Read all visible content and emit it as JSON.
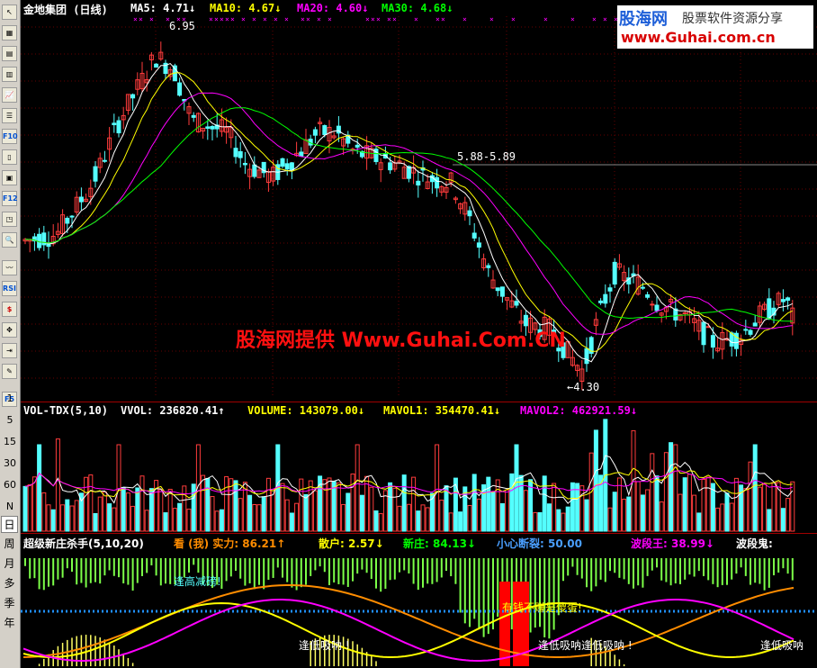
{
  "toolbar": {
    "buttons": [
      {
        "icon": "pointer-icon",
        "glyph": "↖"
      },
      {
        "icon": "grid-icon",
        "glyph": "▦"
      },
      {
        "icon": "table-icon",
        "glyph": "▤"
      },
      {
        "icon": "chart-icon",
        "glyph": "▥"
      },
      {
        "icon": "trend-icon",
        "glyph": "📈"
      },
      {
        "icon": "list-icon",
        "glyph": "☰"
      },
      {
        "icon": "f10-icon",
        "glyph": "F10"
      },
      {
        "icon": "doc-icon",
        "glyph": "▯"
      },
      {
        "icon": "report-icon",
        "glyph": "▣"
      },
      {
        "icon": "f12-icon",
        "glyph": "F12"
      },
      {
        "icon": "window-icon",
        "glyph": "◳"
      },
      {
        "icon": "search-icon",
        "glyph": "🔍"
      },
      {
        "icon": "wave-icon",
        "glyph": "〰"
      },
      {
        "icon": "rsi-icon",
        "glyph": "RSI"
      },
      {
        "icon": "money-icon",
        "glyph": "$"
      },
      {
        "icon": "move-icon",
        "glyph": "✥"
      },
      {
        "icon": "exit-icon",
        "glyph": "⇥"
      },
      {
        "icon": "pencil-icon",
        "glyph": "✎"
      },
      {
        "icon": "f5-icon",
        "glyph": "F5"
      }
    ],
    "minutes": [
      "1",
      "5",
      "15",
      "30",
      "60",
      "N"
    ],
    "periods": [
      "日",
      "周",
      "月",
      "多",
      "季",
      "年"
    ],
    "active_period": "日"
  },
  "main_header": {
    "title": "金地集团 (日线)",
    "ma5": "MA5: 4.71↓",
    "ma10": "MA10: 4.67↓",
    "ma20": "MA20: 4.60↓",
    "ma30": "MA30: 4.68↓"
  },
  "main_annotations": {
    "high": "6.95",
    "mid": "5.88-5.89",
    "low": "←4.30"
  },
  "watermark": "股海网提供 Www.Guhai.Com.CN",
  "logo": {
    "name": "股海网",
    "slogan": "股票软件资源分享",
    "url": "www.Guhai.com.cn"
  },
  "vol_header": {
    "title": "VOL-TDX(5,10)",
    "vvol": "VVOL: 236820.41↑",
    "volume": "VOLUME: 143079.00↓",
    "mavol1": "MAVOL1: 354470.41↓",
    "mavol2": "MAVOL2: 462921.59↓"
  },
  "ind_header": {
    "title": "超级新庄杀手(5,10,20)",
    "kan": "看 (我) 实力: 86.21↑",
    "sanhu": "散户: 2.57↓",
    "xinzhuang": "新庄: 84.13↓",
    "xiaoxin": "小心断裂: 50.00",
    "boduanwang": "波段王: 38.99↓",
    "boduangui": "波段鬼:"
  },
  "ind_annotations": {
    "a1": "逢高减磅!",
    "a2": "逢低吸呐 !",
    "a3": "有钱不赚是傻蛋!",
    "a4": "逢低吸呐逢低吸呐 !",
    "a5": "逢低吸呐"
  },
  "colors": {
    "up": "#ff3c3c",
    "down": "#54ffff",
    "ma5": "#ffffff",
    "ma10": "#ffff00",
    "ma20": "#ff00ff",
    "ma30": "#00ff00",
    "panel_border": "#a00000"
  }
}
